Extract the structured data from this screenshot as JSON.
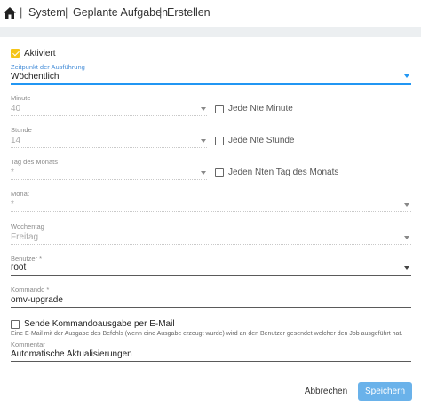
{
  "breadcrumb": {
    "items": [
      "System",
      "Geplante Aufgaben",
      "Erstellen"
    ]
  },
  "form": {
    "enabled": {
      "label": "Aktiviert",
      "checked": true
    },
    "execution_time": {
      "label": "Zeitpunkt der Ausführung",
      "value": "Wöchentlich"
    },
    "minute": {
      "label": "Minute",
      "value": "40",
      "every_label": "Jede Nte Minute"
    },
    "hour": {
      "label": "Stunde",
      "value": "14",
      "every_label": "Jede Nte Stunde"
    },
    "day_of_month": {
      "label": "Tag des Monats",
      "value": "*",
      "every_label": "Jeden Nten Tag des Monats"
    },
    "month": {
      "label": "Monat",
      "value": "*"
    },
    "weekday": {
      "label": "Wochentag",
      "value": "Freitag"
    },
    "user": {
      "label": "Benutzer *",
      "value": "root"
    },
    "command": {
      "label": "Kommando *",
      "value": "omv-upgrade"
    },
    "send_email": {
      "label": "Sende Kommandoausgabe per E-Mail",
      "hint": "Eine E-Mail mit der Ausgabe des Befehls (wenn eine Ausgabe erzeugt wurde) wird an den Benutzer gesendet welcher den Job ausgeführt hat.",
      "checked": false
    },
    "comment": {
      "label": "Kommentar",
      "value": "Automatische Aktualisierungen"
    }
  },
  "actions": {
    "cancel": "Abbrechen",
    "save": "Speichern"
  },
  "colors": {
    "accent": "#2196f3",
    "checkbox_checked": "#f5c518",
    "save_button": "#6ab2ea"
  }
}
